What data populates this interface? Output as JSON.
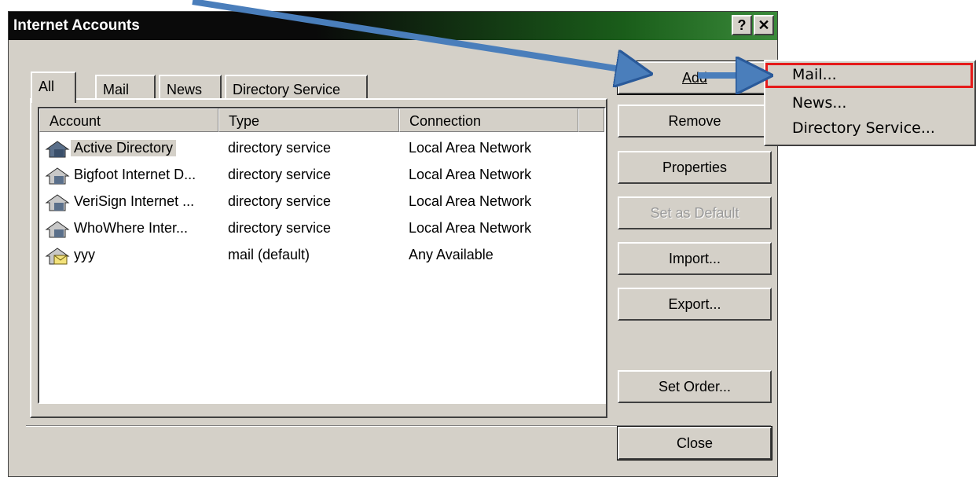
{
  "dialog": {
    "title": "Internet Accounts",
    "help_label": "?",
    "close_label": "✕"
  },
  "tabs": [
    {
      "label": "All",
      "active": true
    },
    {
      "label": "Mail"
    },
    {
      "label": "News"
    },
    {
      "label": "Directory Service"
    }
  ],
  "list": {
    "columns": [
      "Account",
      "Type",
      "Connection"
    ],
    "rows": [
      {
        "account": "Active Directory",
        "type": "directory service",
        "connection": "Local Area Network",
        "icon": "directory-service-icon"
      },
      {
        "account": "Bigfoot Internet D...",
        "type": "directory service",
        "connection": "Local Area Network",
        "icon": "directory-service-icon"
      },
      {
        "account": "VeriSign Internet ...",
        "type": "directory service",
        "connection": "Local Area Network",
        "icon": "directory-service-icon"
      },
      {
        "account": "WhoWhere Inter...",
        "type": "directory service",
        "connection": "Local Area Network",
        "icon": "directory-service-icon"
      },
      {
        "account": "yyy",
        "type": "mail (default)",
        "connection": "Any Available",
        "icon": "mail-account-icon"
      }
    ]
  },
  "buttons": {
    "add": "Add",
    "remove": "Remove",
    "properties": "Properties",
    "set_default": "Set as Default",
    "import": "Import...",
    "export": "Export...",
    "set_order": "Set Order...",
    "close": "Close"
  },
  "add_menu": {
    "items": [
      "Mail...",
      "News...",
      "Directory Service..."
    ],
    "highlighted": "Mail..."
  },
  "colors": {
    "annotation_arrow": "#4a7ebb",
    "highlight_box": "#e51a1a",
    "titlebar_dark": "#0a0a0a",
    "titlebar_green": "#3a8a3a"
  }
}
